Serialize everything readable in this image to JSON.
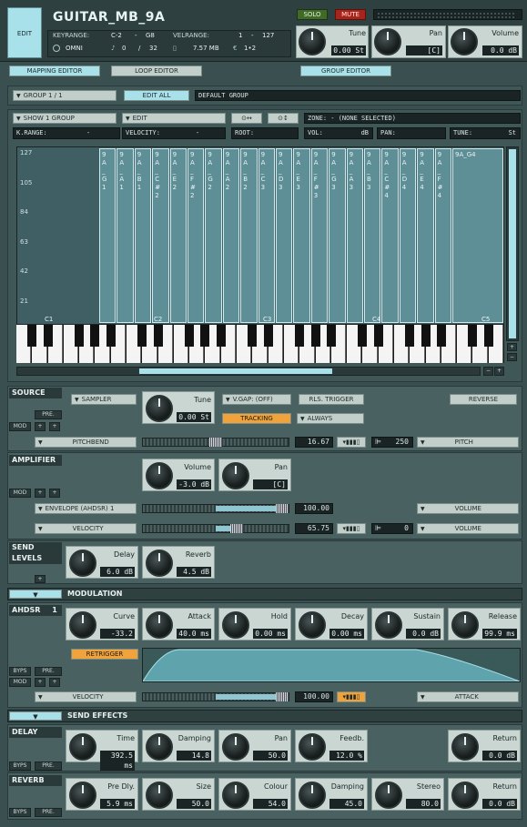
{
  "header": {
    "edit_label": "EDIT",
    "instrument_name": "GUITAR_MB_9A",
    "solo_label": "SOLO",
    "mute_label": "MUTE",
    "keyrange_label": "KEYRANGE:",
    "keyrange_low": "C-2",
    "keyrange_dash": "-",
    "keyrange_high": "G8",
    "velrange_label": "VELRANGE:",
    "velrange_low": "1",
    "velrange_dash": "-",
    "velrange_high": "127",
    "midi_channel": "OMNI",
    "voices_current": "0",
    "voices_sep": "/",
    "voices_max": "32",
    "memory": "7.57 MB",
    "outputs": "1•2",
    "tune_label": "Tune",
    "tune_value": "0.00",
    "tune_unit": "St",
    "pan_label": "Pan",
    "pan_value": "[C]",
    "volume_label": "Volume",
    "volume_value": "0.0",
    "volume_unit": "dB"
  },
  "editor_tabs": {
    "mapping": "MAPPING EDITOR",
    "loop": "LOOP EDITOR",
    "group": "GROUP EDITOR"
  },
  "group_bar": {
    "group_select": "GROUP 1 / 1",
    "edit_all": "EDIT ALL",
    "group_name": "DEFAULT GROUP"
  },
  "mapping": {
    "show_group": "SHOW 1 GROUP",
    "edit": "EDIT",
    "zone_label": "ZONE: - (NONE SELECTED)",
    "krange_label": "K.RANGE:",
    "krange_value": "-",
    "velocity_label": "VELOCITY:",
    "velocity_value": "-",
    "root_label": "ROOT:",
    "vol_label": "VOL:",
    "vol_unit": "dB",
    "pan_label": "PAN:",
    "tune_label": "TUNE:",
    "tune_unit": "St",
    "velocity_ticks": [
      "127",
      "105",
      "84",
      "63",
      "42",
      "21"
    ],
    "octave_labels": [
      "C1",
      "C2",
      "C3",
      "C4",
      "C5"
    ],
    "zones": [
      "9A_G1",
      "9A_A1",
      "9A_B1",
      "9A_C#2",
      "9A_E2",
      "9A_F#2",
      "9A_G2",
      "9A_A2",
      "9A_B2",
      "9A_C3",
      "9A_D3",
      "9A_E3",
      "9A_F#3",
      "9A_G3",
      "9A_A3",
      "9A_B3",
      "9A_C#4",
      "9A_D4",
      "9A_E4",
      "9A_F#4",
      "9A_G4"
    ],
    "last_zone_label": "9A_G4"
  },
  "source": {
    "title": "SOURCE",
    "pre": "PRE.",
    "mod": "MOD",
    "sampler": "SAMPLER",
    "tune_label": "Tune",
    "tune_value": "0.00",
    "tune_unit": "St",
    "vgap": "V.GAP: (OFF)",
    "rls_trigger": "RLS. TRIGGER",
    "reverse": "REVERSE",
    "tracking": "TRACKING",
    "always": "ALWAYS",
    "pitchbend": "PITCHBEND",
    "pitchbend_value": "16.67",
    "pitchbend_level": 0.5,
    "pitch_offset": "250",
    "pitch_target": "PITCH"
  },
  "amplifier": {
    "title": "AMPLIFIER",
    "mod": "MOD",
    "volume_label": "Volume",
    "volume_value": "-3.0",
    "volume_unit": "dB",
    "pan_label": "Pan",
    "pan_value": "[C]",
    "envelope": "ENVELOPE (AHDSR) 1",
    "envelope_value": "100.00",
    "envelope_level": 1.0,
    "envelope_target": "VOLUME",
    "velocity": "VELOCITY",
    "velocity_value": "65.75",
    "velocity_level": 0.66,
    "velocity_offset": "0",
    "velocity_target": "VOLUME"
  },
  "send_levels": {
    "title": "SEND LEVELS",
    "delay_label": "Delay",
    "delay_value": "6.0",
    "delay_unit": "dB",
    "reverb_label": "Reverb",
    "reverb_value": "4.5",
    "reverb_unit": "dB"
  },
  "modulation": {
    "title": "MODULATION",
    "ahdsr_label": "AHDSR",
    "ahdsr_index": "1",
    "curve_label": "Curve",
    "curve_value": "-33.2",
    "attack_label": "Attack",
    "attack_value": "40.0",
    "attack_unit": "ms",
    "hold_label": "Hold",
    "hold_value": "0.00",
    "hold_unit": "ms",
    "decay_label": "Decay",
    "decay_value": "0.00",
    "decay_unit": "ms",
    "sustain_label": "Sustain",
    "sustain_value": "0.0",
    "sustain_unit": "dB",
    "release_label": "Release",
    "release_value": "99.9",
    "release_unit": "ms",
    "retrigger": "RETRIGGER",
    "byps": "BYPS",
    "pre": "PRE.",
    "mod": "MOD",
    "velocity": "VELOCITY",
    "velocity_value": "100.00",
    "velocity_level": 1.0,
    "velocity_target": "ATTACK"
  },
  "send_effects": {
    "title": "SEND EFFECTS",
    "delay": {
      "title": "DELAY",
      "byps": "BYPS",
      "pre": "PRE.",
      "time_label": "Time",
      "time_value": "392.5",
      "time_unit": "ms",
      "damping_label": "Damping",
      "damping_value": "14.8",
      "pan_label": "Pan",
      "pan_value": "50.0",
      "feedb_label": "Feedb.",
      "feedb_value": "12.0",
      "feedb_unit": "%",
      "return_label": "Return",
      "return_value": "0.0",
      "return_unit": "dB"
    },
    "reverb": {
      "title": "REVERB",
      "byps": "BYPS",
      "pre": "PRE.",
      "predly_label": "Pre Dly.",
      "predly_value": "5.9",
      "predly_unit": "ms",
      "size_label": "Size",
      "size_value": "50.0",
      "colour_label": "Colour",
      "colour_value": "54.0",
      "damping_label": "Damping",
      "damping_value": "45.0",
      "stereo_label": "Stereo",
      "stereo_value": "80.0",
      "return_label": "Return",
      "return_value": "0.0",
      "return_unit": "dB"
    }
  },
  "colors": {
    "accent_teal": "#a9e1ea",
    "accent_orange": "#f0a33a",
    "solo_green": "#3f6a2a",
    "mute_red": "#a8231a",
    "panel": "#3f5757",
    "lcd": "#1a2424"
  }
}
